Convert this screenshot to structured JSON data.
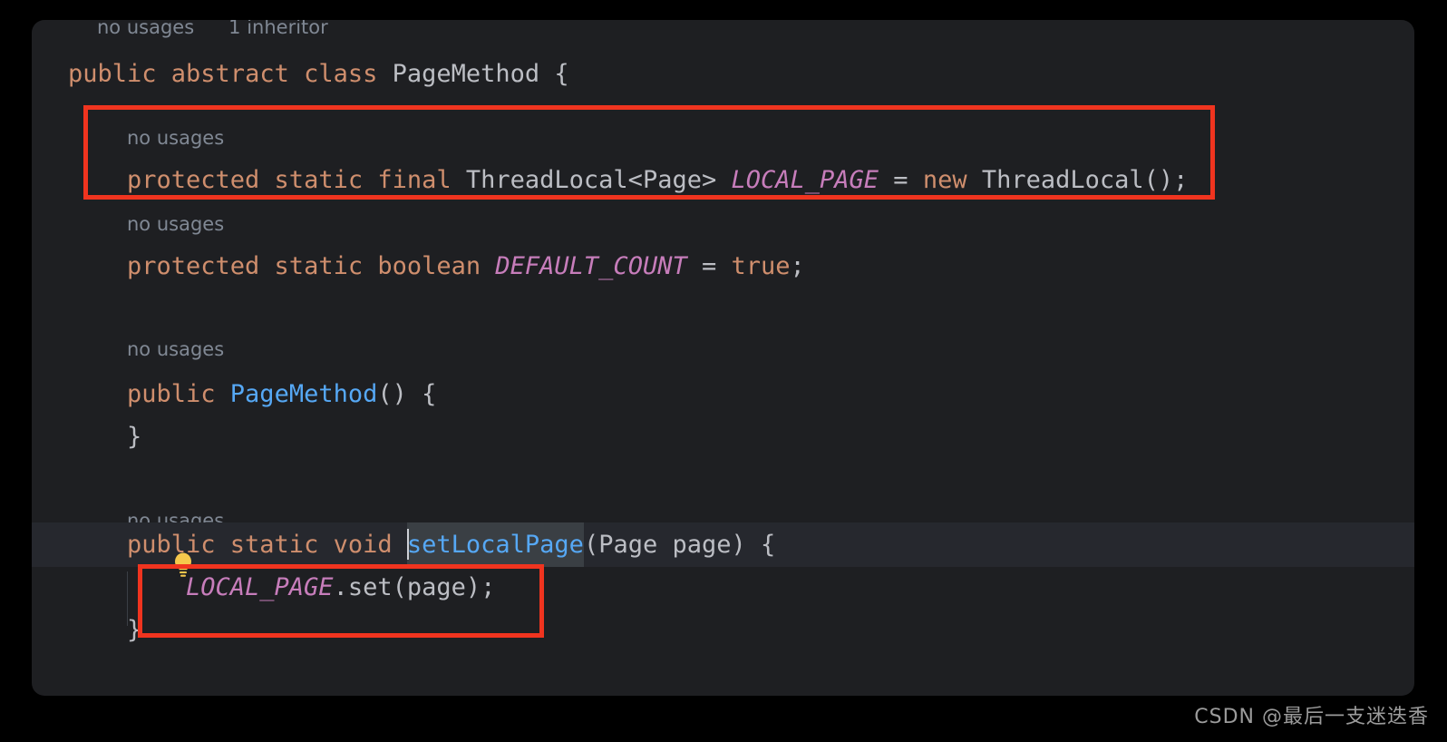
{
  "editor": {
    "colors": {
      "panel_background": "#1e1f22",
      "outside_background": "#000000",
      "current_line_background": "#26282e",
      "keyword": "#cf8e6d",
      "plain_text": "#bcbec4",
      "method_name": "#56a8f5",
      "static_field": "#c77dbb",
      "hint_gray": "#808894",
      "annotation_red": "#f0341f",
      "identifier_highlight": "#3a3f44"
    },
    "top_cut_hints": {
      "usages": "no usages",
      "inheritors": "1 inheritor"
    },
    "lines": [
      {
        "id": "class-declaration",
        "tokens": [
          {
            "kind": "kw",
            "text": "public abstract class "
          },
          {
            "kind": "cls",
            "text": "PageMethod {"
          }
        ]
      },
      {
        "id": "local-page-hint",
        "hint": "no usages"
      },
      {
        "id": "local-page-field",
        "tokens": [
          {
            "kind": "kw",
            "text": "protected static final "
          },
          {
            "kind": "txt",
            "text": "ThreadLocal<Page> "
          },
          {
            "kind": "sfld",
            "text": "LOCAL_PAGE"
          },
          {
            "kind": "txt",
            "text": " = "
          },
          {
            "kind": "kw",
            "text": "new "
          },
          {
            "kind": "txt",
            "text": "ThreadLocal();"
          }
        ]
      },
      {
        "id": "default-count-hint",
        "hint": "no usages"
      },
      {
        "id": "default-count-field",
        "tokens": [
          {
            "kind": "kw",
            "text": "protected static boolean "
          },
          {
            "kind": "sfld",
            "text": "DEFAULT_COUNT"
          },
          {
            "kind": "txt",
            "text": " = "
          },
          {
            "kind": "kw",
            "text": "true"
          },
          {
            "kind": "txt",
            "text": ";"
          }
        ]
      },
      {
        "id": "constructor-hint",
        "hint": "no usages"
      },
      {
        "id": "constructor-signature",
        "tokens": [
          {
            "kind": "kw",
            "text": "public "
          },
          {
            "kind": "fn",
            "text": "PageMethod"
          },
          {
            "kind": "txt",
            "text": "() {"
          }
        ]
      },
      {
        "id": "constructor-close",
        "tokens": [
          {
            "kind": "txt",
            "text": "}"
          }
        ]
      },
      {
        "id": "setlocalpage-hint",
        "hint": "no usages"
      },
      {
        "id": "setlocalpage-signature",
        "tokens": [
          {
            "kind": "kw",
            "text": "public static void "
          },
          {
            "kind": "caret",
            "text": ""
          },
          {
            "kind": "ident-hl",
            "text": "setLocalPage"
          },
          {
            "kind": "txt",
            "text": "(Page page) {"
          }
        ]
      },
      {
        "id": "setlocalpage-body",
        "tokens": [
          {
            "kind": "sfld",
            "text": "LOCAL_PAGE"
          },
          {
            "kind": "txt",
            "text": ".set(page);"
          }
        ]
      },
      {
        "id": "setlocalpage-close",
        "tokens": [
          {
            "kind": "txt",
            "text": "}"
          }
        ]
      }
    ],
    "lightbulb": {
      "icon": "lightbulb-icon",
      "color": "#f5c84c"
    },
    "annotations": [
      {
        "id": "highlight-local-page-field",
        "label": "red-rectangle-local-page-declaration"
      },
      {
        "id": "highlight-local-page-set",
        "label": "red-rectangle-local-page-set-call"
      }
    ]
  },
  "watermark": {
    "text": "CSDN @最后一支迷迭香"
  }
}
